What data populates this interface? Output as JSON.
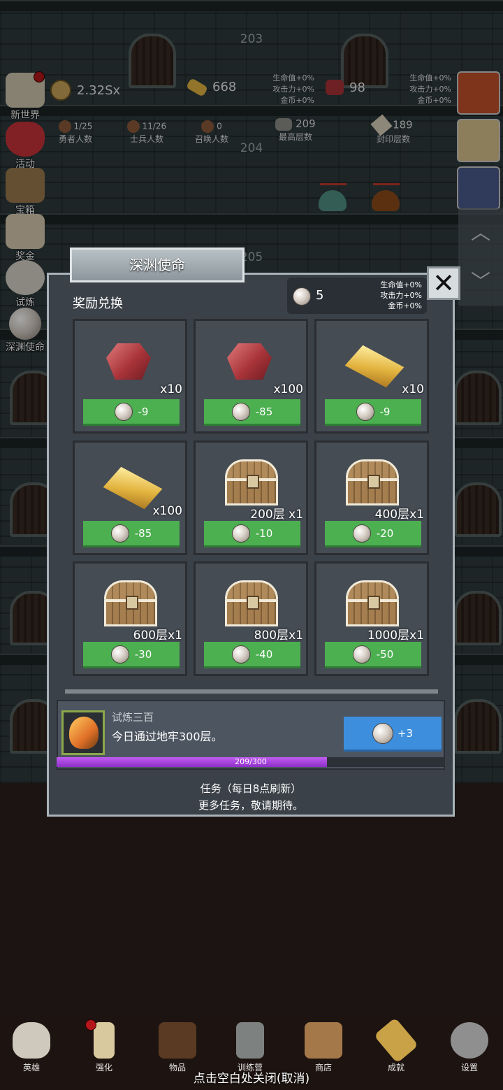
{
  "background": {
    "floors": [
      "203",
      "204",
      "205"
    ]
  },
  "hud": {
    "coins": "2.32Sx",
    "gold_bars": "668",
    "gems": "98",
    "left_bonus": [
      "生命值+0%",
      "攻击力+0%",
      "金币+0%"
    ],
    "right_bonus": [
      "生命值+0%",
      "攻击力+0%",
      "金币+0%"
    ],
    "heroes": {
      "value": "1/25",
      "label": "勇者人数"
    },
    "soldiers": {
      "value": "11/26",
      "label": "士兵人数"
    },
    "summons": {
      "value": "0",
      "label": "召唤人数"
    },
    "max_floor": {
      "value": "209",
      "label": "最高层数"
    },
    "sealed_floor": {
      "value": "189",
      "label": "封印层数"
    }
  },
  "left_menu": [
    "新世界",
    "活动",
    "宝箱",
    "奖金",
    "试炼",
    "深渊使命"
  ],
  "dialog": {
    "title": "深渊使命",
    "section_label": "奖励兑换",
    "pearls": "5",
    "bonus": [
      "生命值+0%",
      "攻击力+0%",
      "金币+0%"
    ],
    "rewards": [
      {
        "icon": "gem-icon",
        "qty": "x10",
        "price": "-9"
      },
      {
        "icon": "gem-icon",
        "qty": "x100",
        "price": "-85"
      },
      {
        "icon": "gold-bar-icon",
        "qty": "x10",
        "price": "-9"
      },
      {
        "icon": "gold-bar-icon",
        "qty": "x100",
        "price": "-85"
      },
      {
        "icon": "chest-icon",
        "qty": "200层 x1",
        "price": "-10"
      },
      {
        "icon": "chest-icon",
        "qty": "400层x1",
        "price": "-20"
      },
      {
        "icon": "chest-icon",
        "qty": "600层x1",
        "price": "-30"
      },
      {
        "icon": "chest-icon",
        "qty": "800层x1",
        "price": "-40"
      },
      {
        "icon": "chest-icon",
        "qty": "1000层x1",
        "price": "-50"
      }
    ],
    "task": {
      "title": "试炼三百",
      "desc": "今日通过地牢300层。",
      "reward": "+3",
      "progress_text": "209/300",
      "progress_value": 0.6967
    },
    "footer_line1": "任务（每日8点刷新）",
    "footer_line2": "更多任务，敬请期待。"
  },
  "bottom_nav": [
    "英雄",
    "强化",
    "物品",
    "训练营",
    "商店",
    "成就",
    "设置"
  ],
  "close_hint": "点击空白处关闭(取消)",
  "colors": {
    "buy_green": "#4caf50",
    "task_blue": "#3d8fde",
    "progress_purple": "#a442e0",
    "dialog_bg": "#3b4148"
  }
}
